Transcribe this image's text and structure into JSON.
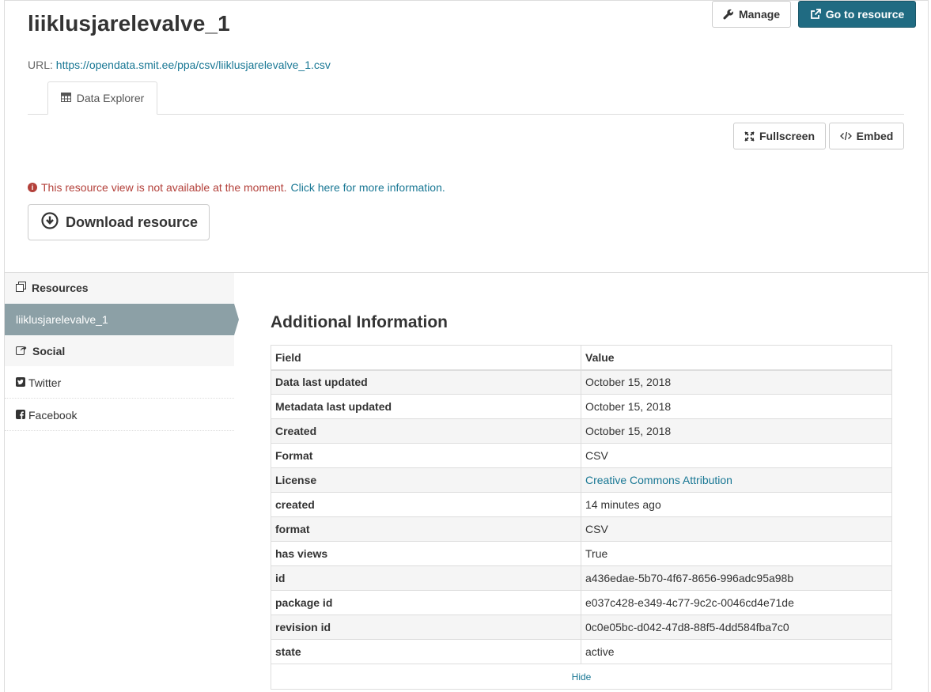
{
  "resource": {
    "title": "liiklusjarelevalve_1",
    "url_label": "URL:",
    "url": "https://opendata.smit.ee/ppa/csv/liiklusjarelevalve_1.csv"
  },
  "actions": {
    "manage_label": "Manage",
    "go_to_resource_label": "Go to resource",
    "fullscreen_label": "Fullscreen",
    "embed_label": "Embed",
    "download_label": "Download resource"
  },
  "tabs": [
    {
      "label": "Data Explorer",
      "icon": "table-icon"
    }
  ],
  "notice": {
    "message": "This resource view is not available at the moment.",
    "link_text": "Click here for more information."
  },
  "sidebar": {
    "resources_heading": "Resources",
    "active_resource": "liiklusjarelevalve_1",
    "social_heading": "Social",
    "social_items": [
      {
        "label": "Twitter",
        "icon": "twitter-icon"
      },
      {
        "label": "Facebook",
        "icon": "facebook-icon"
      }
    ]
  },
  "additional_info": {
    "title": "Additional Information",
    "columns": [
      "Field",
      "Value"
    ],
    "rows": [
      {
        "field": "Data last updated",
        "value": "October 15, 2018"
      },
      {
        "field": "Metadata last updated",
        "value": "October 15, 2018"
      },
      {
        "field": "Created",
        "value": "October 15, 2018"
      },
      {
        "field": "Format",
        "value": "CSV"
      },
      {
        "field": "License",
        "value": "Creative Commons Attribution"
      },
      {
        "field": "created",
        "value": "14 minutes ago"
      },
      {
        "field": "format",
        "value": "CSV"
      },
      {
        "field": "has views",
        "value": "True"
      },
      {
        "field": "id",
        "value": "a436edae-5b70-4f67-8656-996adc95a98b"
      },
      {
        "field": "package id",
        "value": "e037c428-e349-4c77-9c2c-0046cd4e71de"
      },
      {
        "field": "revision id",
        "value": "0c0e05bc-d042-47d8-88f5-4dd584fba7c0"
      },
      {
        "field": "state",
        "value": "active"
      }
    ],
    "hide_label": "Hide"
  },
  "colors": {
    "primary": "#206b82",
    "link": "#187794",
    "error": "#b3403a",
    "sidebar_active": "#8ca0a6"
  }
}
